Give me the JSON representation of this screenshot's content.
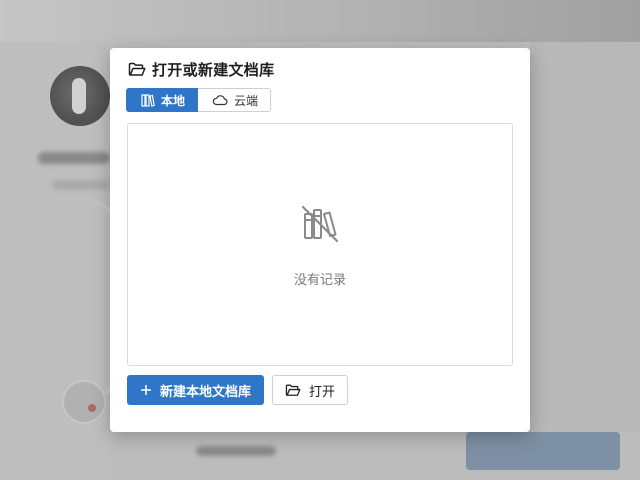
{
  "dialog": {
    "title": "打开或新建文档库",
    "title_icon": "folder-open-icon"
  },
  "tabs": [
    {
      "label": "本地",
      "icon": "library-icon",
      "active": true
    },
    {
      "label": "云端",
      "icon": "cloud-icon",
      "active": false
    }
  ],
  "records": {
    "empty_text": "没有记录",
    "empty_icon": "library-off-icon"
  },
  "actions": {
    "create_local_label": "新建本地文档库",
    "create_local_icon": "plus-icon",
    "open_label": "打开",
    "open_icon": "folder-open-icon"
  },
  "colors": {
    "accent": "#2f76c8",
    "border": "#cfcfcf",
    "muted_text": "#7a7a7a"
  }
}
